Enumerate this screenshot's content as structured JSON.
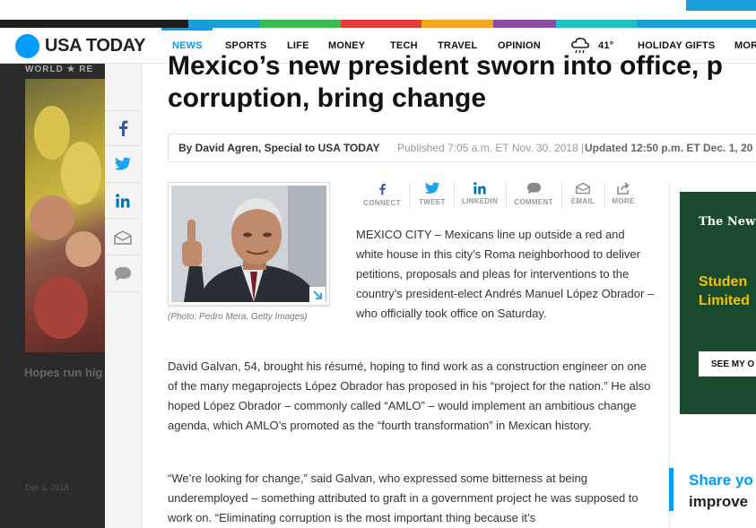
{
  "nav": {
    "logo": "USA TODAY",
    "items": [
      "NEWS",
      "SPORTS",
      "LIFE",
      "MONEY",
      "TECH",
      "TRAVEL",
      "OPINION"
    ],
    "active": "NEWS",
    "weather_temp": "41°",
    "holiday": "HOLIDAY GIFTS",
    "more": "MOR"
  },
  "background": {
    "section_tag": "WORLD ★ RE",
    "headline_fragment": "Hopes run hig",
    "date": "Dec 1, 2018"
  },
  "article": {
    "headline_line1": "Mexico’s new president sworn into office, p",
    "headline_line2": "corruption, bring change",
    "byline": "By David Agren, Special to USA TODAY",
    "published": "Published 7:05 a.m. ET Nov. 30, 2018",
    "separator": "|",
    "updated_label": "Updated",
    "updated_time": "12:50 p.m. ET Dec. 1, 20",
    "caption": "(Photo: Pedro Mera, Getty Images)",
    "share_buttons": [
      "CONNECT",
      "TWEET",
      "LINKEDIN",
      "COMMENT",
      "EMAIL",
      "MORE"
    ],
    "para1": "MEXICO CITY – Mexicans line up outside a red and white house in this city’s Roma neighborhood to deliver petitions, proposals and pleas for interventions to the country’s president-elect Andrés Manuel López Obrador – who officially took office on Saturday.",
    "para2": "David Galvan, 54, brought his résumé, hoping to find work as a construction engineer on one of the many megaprojects López Obrador has proposed in his “project for the nation.” He also hoped López Obrador – commonly called “AMLO” – would implement an ambitious change agenda, which AMLO’s promoted as the “fourth transformation” in Mexican history.",
    "para3": "“We’re looking for change,” said Galvan, who expressed some bitterness at being underemployed – something attributed to graft in a government project he was supposed to work on. “Eliminating corruption is the most important thing because it’s"
  },
  "ad": {
    "brand": "The New Yo",
    "line1": "Studen",
    "line2": "Limited",
    "button": "SEE MY O"
  },
  "promo": {
    "line1": "Share yo",
    "line2": "improve"
  },
  "colors": {
    "brand_blue": "#009bff",
    "ad_green": "#1a4a2d",
    "ad_yellow": "#f4c400",
    "facebook": "#3b5998",
    "twitter": "#1da1f2",
    "linkedin": "#0077b5"
  }
}
